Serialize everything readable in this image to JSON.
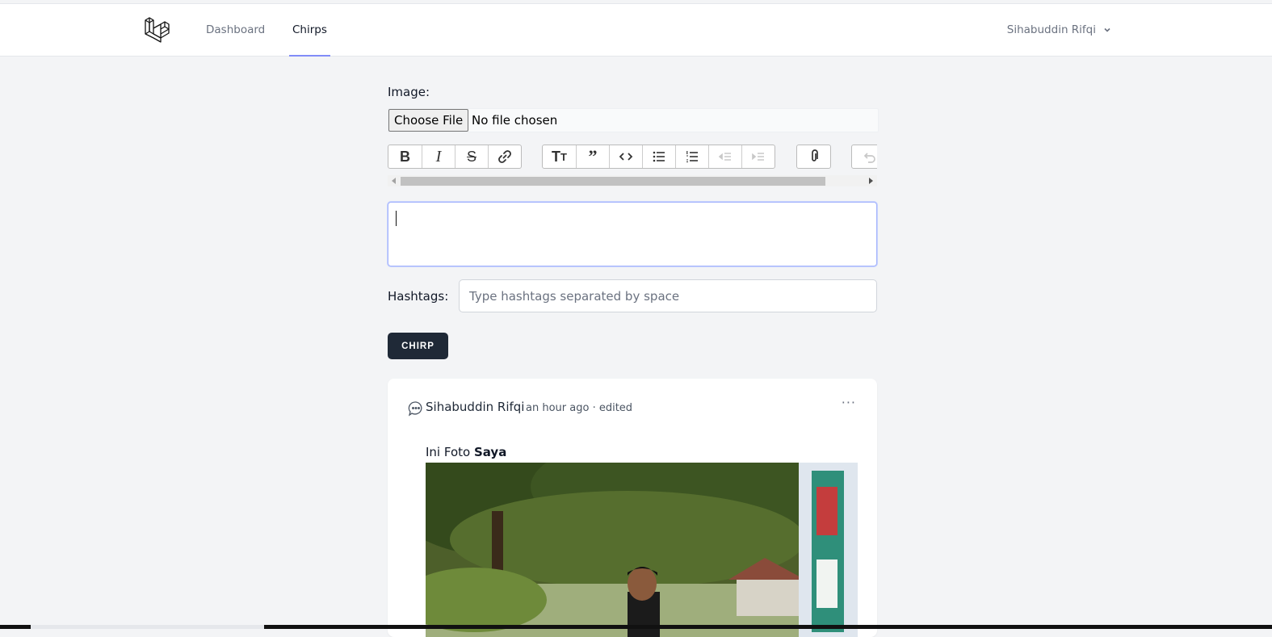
{
  "nav": {
    "logo_icon": "laravel-logo-icon",
    "links": [
      {
        "label": "Dashboard",
        "active": false
      },
      {
        "label": "Chirps",
        "active": true
      }
    ],
    "user_name": "Sihabuddin Rifqi",
    "dropdown_icon": "chevron-down-icon"
  },
  "form": {
    "image_label": "Image:",
    "file_button": "Choose File",
    "file_status": "No file chosen",
    "toolbar": [
      {
        "name": "bold-icon",
        "glyph": "B"
      },
      {
        "name": "italic-icon",
        "glyph": "I"
      },
      {
        "name": "strikethrough-icon",
        "glyph": "S"
      },
      {
        "name": "link-icon",
        "glyph": "link"
      },
      {
        "name": "heading-icon",
        "glyph": "TT"
      },
      {
        "name": "quote-icon",
        "glyph": "quote"
      },
      {
        "name": "code-icon",
        "glyph": "code"
      },
      {
        "name": "bullet-list-icon",
        "glyph": "ul"
      },
      {
        "name": "numbered-list-icon",
        "glyph": "ol"
      },
      {
        "name": "decrease-indent-icon",
        "glyph": "outdent",
        "disabled": true
      },
      {
        "name": "increase-indent-icon",
        "glyph": "indent",
        "disabled": true
      },
      {
        "name": "attach-file-icon",
        "glyph": "clip"
      },
      {
        "name": "undo-icon",
        "glyph": "undo",
        "disabled": true
      }
    ],
    "message_value": "",
    "hashtags_label": "Hashtags:",
    "hashtags_placeholder": "Type hashtags separated by space",
    "hashtags_value": "",
    "submit_label": "CHIRP"
  },
  "chirps": [
    {
      "author": "Sihabuddin Rifqi",
      "time": "an hour ago",
      "edited_label": "· edited",
      "text_plain": "Ini Foto ",
      "text_bold": "Saya",
      "has_image": true
    }
  ],
  "colors": {
    "background": "#f3f4f6",
    "button_dark": "#1f2937",
    "focus_ring": "#a5b4fc",
    "active_tab_underline": "#818cf8"
  }
}
